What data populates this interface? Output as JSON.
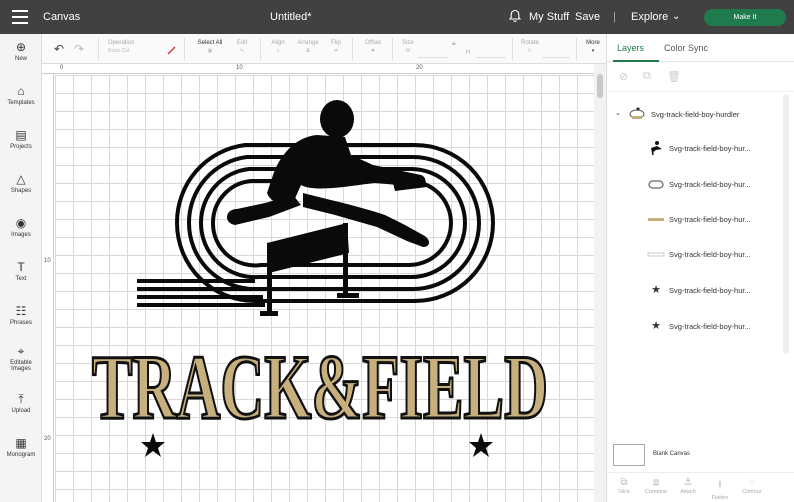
{
  "topbar": {
    "section": "Canvas",
    "document_title": "Untitled*",
    "my_stuff": "My Stuff",
    "save": "Save",
    "divider": "|",
    "explore": "Explore",
    "explore_chevron": "⌄",
    "make_it": "Make It"
  },
  "leftbar": [
    {
      "label": "New",
      "icon": "⊕"
    },
    {
      "label": "Templates",
      "icon": "⌂"
    },
    {
      "label": "Projects",
      "icon": "▤"
    },
    {
      "label": "Shapes",
      "icon": "△"
    },
    {
      "label": "Images",
      "icon": "◉"
    },
    {
      "label": "Text",
      "icon": "T"
    },
    {
      "label": "Phrases",
      "icon": "☷"
    },
    {
      "label": "Editable Images",
      "icon": "⌖"
    },
    {
      "label": "Upload",
      "icon": "⤒"
    },
    {
      "label": "Monogram",
      "icon": "▦"
    }
  ],
  "toolbar": {
    "undo_icon": "↶",
    "redo_icon": "↷",
    "operation_label": "Operation",
    "operation_value": "Basic Cut",
    "select_all": "Select All",
    "edit": "Edit",
    "align": "Align",
    "arrange": "Arrange",
    "flip": "Flip",
    "offset": "Offset",
    "size": "Size",
    "size_w": "W",
    "size_h": "H",
    "rotate": "Rotate",
    "more": "More"
  },
  "rulers": {
    "top": [
      "0",
      "10",
      "20"
    ],
    "left": [
      "10",
      "20"
    ]
  },
  "design": {
    "title_text": "TRACK&FIELD",
    "title_fill": "#c7b07d",
    "title_stroke": "#111111",
    "ink": "#0a0a0a",
    "star": "★"
  },
  "right_panel": {
    "tabs": [
      "Layers",
      "Color Sync"
    ],
    "group_name": "Svg-track-field-boy-hurdler",
    "layers": [
      {
        "name": "Svg-track-field-boy-hur...",
        "thumb": "hurdler-icon"
      },
      {
        "name": "Svg-track-field-boy-hur...",
        "thumb": "track-icon"
      },
      {
        "name": "Svg-track-field-boy-hur...",
        "thumb": "text-icon"
      },
      {
        "name": "Svg-track-field-boy-hur...",
        "thumb": "text-outline-icon"
      },
      {
        "name": "Svg-track-field-boy-hur...",
        "thumb": "star-icon"
      },
      {
        "name": "Svg-track-field-boy-hur...",
        "thumb": "star-icon"
      }
    ],
    "blank_canvas": "Blank Canvas",
    "bottom_actions": [
      "Slice",
      "Combine",
      "Attach",
      "Flatten",
      "Contour"
    ]
  },
  "colors": {
    "topbar": "#414141",
    "accent_green": "#1f7a4d",
    "text_gold": "#c7b07d"
  }
}
